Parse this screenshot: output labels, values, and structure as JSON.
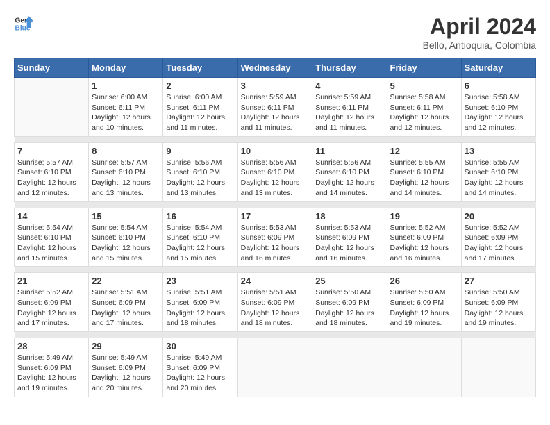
{
  "header": {
    "logo_line1": "General",
    "logo_line2": "Blue",
    "month_title": "April 2024",
    "location": "Bello, Antioquia, Colombia"
  },
  "weekdays": [
    "Sunday",
    "Monday",
    "Tuesday",
    "Wednesday",
    "Thursday",
    "Friday",
    "Saturday"
  ],
  "weeks": [
    [
      {
        "day": "",
        "info": ""
      },
      {
        "day": "1",
        "info": "Sunrise: 6:00 AM\nSunset: 6:11 PM\nDaylight: 12 hours\nand 10 minutes."
      },
      {
        "day": "2",
        "info": "Sunrise: 6:00 AM\nSunset: 6:11 PM\nDaylight: 12 hours\nand 11 minutes."
      },
      {
        "day": "3",
        "info": "Sunrise: 5:59 AM\nSunset: 6:11 PM\nDaylight: 12 hours\nand 11 minutes."
      },
      {
        "day": "4",
        "info": "Sunrise: 5:59 AM\nSunset: 6:11 PM\nDaylight: 12 hours\nand 11 minutes."
      },
      {
        "day": "5",
        "info": "Sunrise: 5:58 AM\nSunset: 6:11 PM\nDaylight: 12 hours\nand 12 minutes."
      },
      {
        "day": "6",
        "info": "Sunrise: 5:58 AM\nSunset: 6:10 PM\nDaylight: 12 hours\nand 12 minutes."
      }
    ],
    [
      {
        "day": "7",
        "info": "Sunrise: 5:57 AM\nSunset: 6:10 PM\nDaylight: 12 hours\nand 12 minutes."
      },
      {
        "day": "8",
        "info": "Sunrise: 5:57 AM\nSunset: 6:10 PM\nDaylight: 12 hours\nand 13 minutes."
      },
      {
        "day": "9",
        "info": "Sunrise: 5:56 AM\nSunset: 6:10 PM\nDaylight: 12 hours\nand 13 minutes."
      },
      {
        "day": "10",
        "info": "Sunrise: 5:56 AM\nSunset: 6:10 PM\nDaylight: 12 hours\nand 13 minutes."
      },
      {
        "day": "11",
        "info": "Sunrise: 5:56 AM\nSunset: 6:10 PM\nDaylight: 12 hours\nand 14 minutes."
      },
      {
        "day": "12",
        "info": "Sunrise: 5:55 AM\nSunset: 6:10 PM\nDaylight: 12 hours\nand 14 minutes."
      },
      {
        "day": "13",
        "info": "Sunrise: 5:55 AM\nSunset: 6:10 PM\nDaylight: 12 hours\nand 14 minutes."
      }
    ],
    [
      {
        "day": "14",
        "info": "Sunrise: 5:54 AM\nSunset: 6:10 PM\nDaylight: 12 hours\nand 15 minutes."
      },
      {
        "day": "15",
        "info": "Sunrise: 5:54 AM\nSunset: 6:10 PM\nDaylight: 12 hours\nand 15 minutes."
      },
      {
        "day": "16",
        "info": "Sunrise: 5:54 AM\nSunset: 6:10 PM\nDaylight: 12 hours\nand 15 minutes."
      },
      {
        "day": "17",
        "info": "Sunrise: 5:53 AM\nSunset: 6:09 PM\nDaylight: 12 hours\nand 16 minutes."
      },
      {
        "day": "18",
        "info": "Sunrise: 5:53 AM\nSunset: 6:09 PM\nDaylight: 12 hours\nand 16 minutes."
      },
      {
        "day": "19",
        "info": "Sunrise: 5:52 AM\nSunset: 6:09 PM\nDaylight: 12 hours\nand 16 minutes."
      },
      {
        "day": "20",
        "info": "Sunrise: 5:52 AM\nSunset: 6:09 PM\nDaylight: 12 hours\nand 17 minutes."
      }
    ],
    [
      {
        "day": "21",
        "info": "Sunrise: 5:52 AM\nSunset: 6:09 PM\nDaylight: 12 hours\nand 17 minutes."
      },
      {
        "day": "22",
        "info": "Sunrise: 5:51 AM\nSunset: 6:09 PM\nDaylight: 12 hours\nand 17 minutes."
      },
      {
        "day": "23",
        "info": "Sunrise: 5:51 AM\nSunset: 6:09 PM\nDaylight: 12 hours\nand 18 minutes."
      },
      {
        "day": "24",
        "info": "Sunrise: 5:51 AM\nSunset: 6:09 PM\nDaylight: 12 hours\nand 18 minutes."
      },
      {
        "day": "25",
        "info": "Sunrise: 5:50 AM\nSunset: 6:09 PM\nDaylight: 12 hours\nand 18 minutes."
      },
      {
        "day": "26",
        "info": "Sunrise: 5:50 AM\nSunset: 6:09 PM\nDaylight: 12 hours\nand 19 minutes."
      },
      {
        "day": "27",
        "info": "Sunrise: 5:50 AM\nSunset: 6:09 PM\nDaylight: 12 hours\nand 19 minutes."
      }
    ],
    [
      {
        "day": "28",
        "info": "Sunrise: 5:49 AM\nSunset: 6:09 PM\nDaylight: 12 hours\nand 19 minutes."
      },
      {
        "day": "29",
        "info": "Sunrise: 5:49 AM\nSunset: 6:09 PM\nDaylight: 12 hours\nand 20 minutes."
      },
      {
        "day": "30",
        "info": "Sunrise: 5:49 AM\nSunset: 6:09 PM\nDaylight: 12 hours\nand 20 minutes."
      },
      {
        "day": "",
        "info": ""
      },
      {
        "day": "",
        "info": ""
      },
      {
        "day": "",
        "info": ""
      },
      {
        "day": "",
        "info": ""
      }
    ]
  ]
}
